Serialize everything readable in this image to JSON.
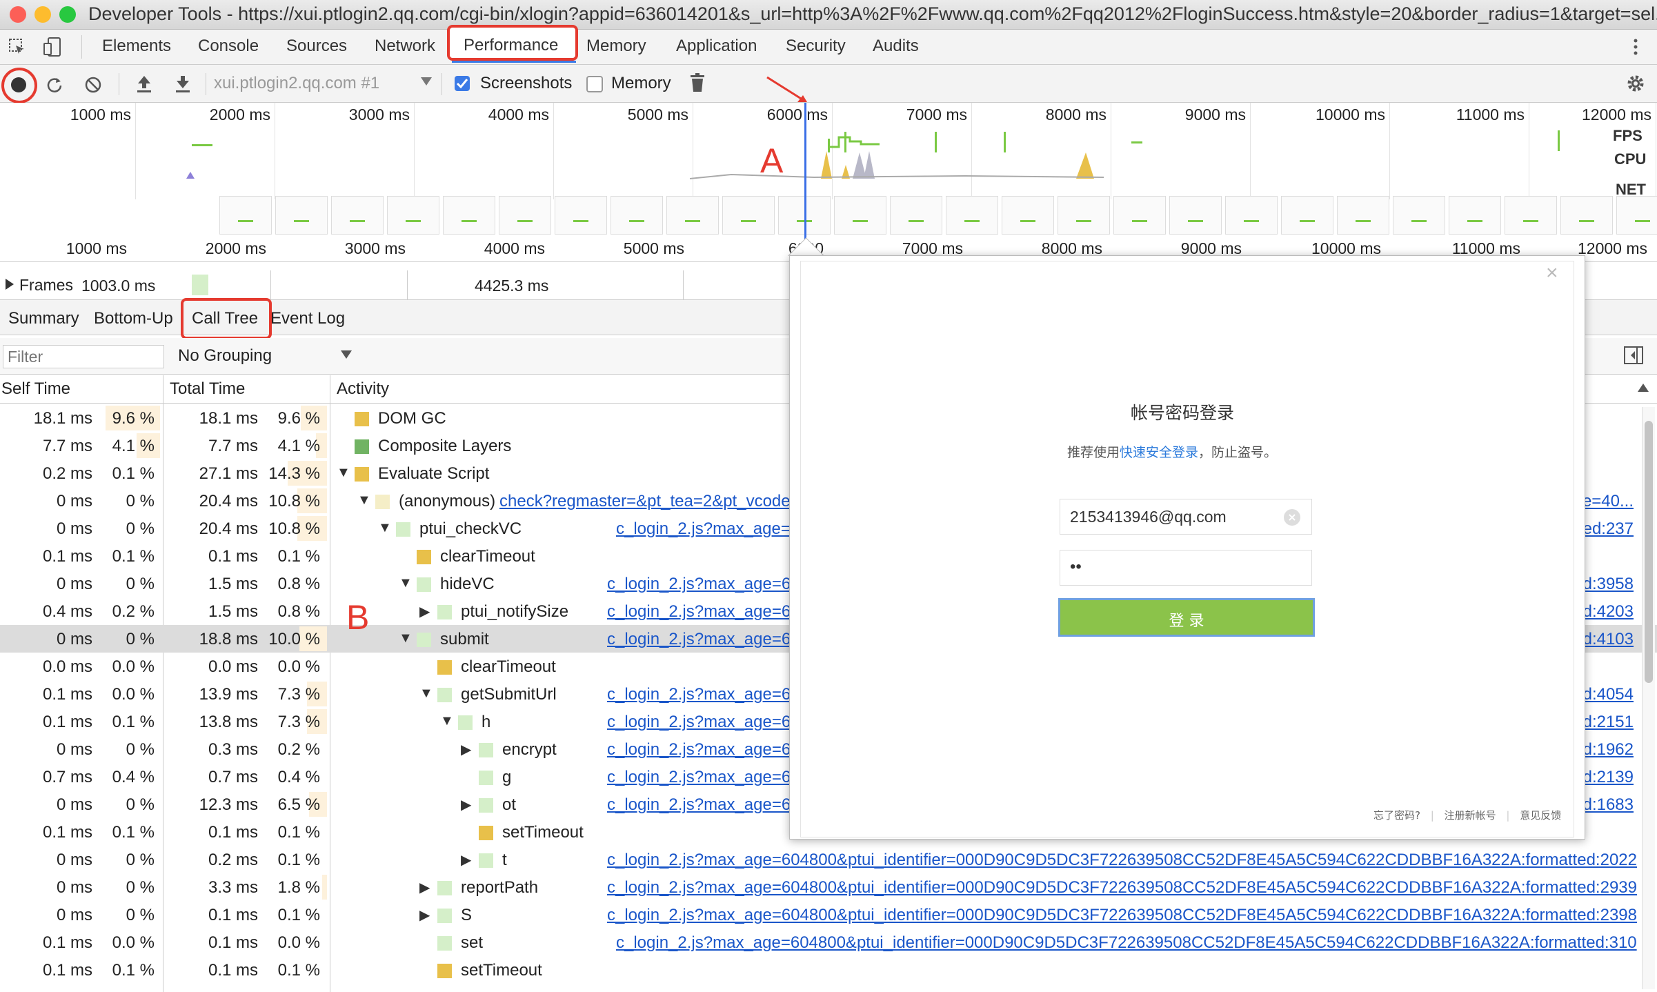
{
  "window": {
    "title": "Developer Tools - https://xui.ptlogin2.qq.com/cgi-bin/xlogin?appid=636014201&s_url=http%3A%2F%2Fwww.qq.com%2Fqq2012%2FloginSuccess.htm&style=20&border_radius=1&target=sel..."
  },
  "colors": {
    "annotation": "#e53a2f",
    "link": "#1a56c9",
    "login_button": "#8bc34a",
    "fps": "#7ac943",
    "cpu_script": "#e8c04a"
  },
  "tabs": [
    "Elements",
    "Console",
    "Sources",
    "Network",
    "Performance",
    "Memory",
    "Application",
    "Security",
    "Audits"
  ],
  "toolbar": {
    "target": "xui.ptlogin2.qq.com #1",
    "screenshots": "Screenshots",
    "memory": "Memory"
  },
  "overview": {
    "ticks_top": [
      "1000 ms",
      "2000 ms",
      "3000 ms",
      "4000 ms",
      "5000 ms",
      "6000 ms",
      "7000 ms",
      "8000 ms",
      "9000 ms",
      "10000 ms",
      "11000 ms",
      "12000 ms"
    ],
    "ticks_bottom": [
      "1000 ms",
      "2000 ms",
      "3000 ms",
      "4000 ms",
      "5000 ms",
      "6000",
      "7000 ms",
      "8000 ms",
      "9000 ms",
      "10000 ms",
      "11000 ms",
      "12000 ms"
    ],
    "labels": {
      "fps": "FPS",
      "cpu": "CPU",
      "net": "NET"
    }
  },
  "frames": {
    "label": "Frames",
    "value1": "1003.0 ms",
    "value2": "4425.3 ms"
  },
  "bottom_tabs": [
    "Summary",
    "Bottom-Up",
    "Call Tree",
    "Event Log"
  ],
  "filter": {
    "placeholder": "Filter",
    "grouping": "No Grouping"
  },
  "headers": {
    "self": "Self Time",
    "total": "Total Time",
    "activity": "Activity"
  },
  "rows": [
    {
      "self": "18.1 ms",
      "selfp": "9.6 %",
      "total": "18.1 ms",
      "totalp": "9.6 %",
      "name": "DOM GC",
      "color": "#e8c04a",
      "link": ""
    },
    {
      "self": "7.7 ms",
      "selfp": "4.1 %",
      "total": "7.7 ms",
      "totalp": "4.1 %",
      "name": "Composite Layers",
      "color": "#71b363",
      "link": ""
    },
    {
      "self": "0.2 ms",
      "selfp": "0.1 %",
      "total": "27.1 ms",
      "totalp": "14.3 %",
      "name": "Evaluate Script",
      "color": "#e8c04a",
      "link": ""
    },
    {
      "self": "0 ms",
      "selfp": "0 %",
      "total": "20.4 ms",
      "totalp": "10.8 %",
      "name": "(anonymous)",
      "color": "#f5eec7",
      "link": "check?regmaster=&pt_tea=2&pt_vcode",
      "link2": "e=40..."
    },
    {
      "self": "0 ms",
      "selfp": "0 %",
      "total": "20.4 ms",
      "totalp": "10.8 %",
      "name": "ptui_checkVC",
      "color": "#d5efc9",
      "link": "c_login_2.js?max_age=",
      "link2": "ted:237"
    },
    {
      "self": "0.1 ms",
      "selfp": "0.1 %",
      "total": "0.1 ms",
      "totalp": "0.1 %",
      "name": "clearTimeout",
      "color": "#e8c04a",
      "link": ""
    },
    {
      "self": "0 ms",
      "selfp": "0 %",
      "total": "1.5 ms",
      "totalp": "0.8 %",
      "name": "hideVC",
      "color": "#d5efc9",
      "link": "c_login_2.js?max_age=6",
      "link2": "d:3958"
    },
    {
      "self": "0.4 ms",
      "selfp": "0.2 %",
      "total": "1.5 ms",
      "totalp": "0.8 %",
      "name": "ptui_notifySize",
      "color": "#d5efc9",
      "link": "c_login_2.js?max_age=6",
      "link2": "d:4203"
    },
    {
      "self": "0 ms",
      "selfp": "0 %",
      "total": "18.8 ms",
      "totalp": "10.0 %",
      "name": "submit",
      "color": "#d5efc9",
      "link": "c_login_2.js?max_age=6",
      "link2": "d:4103"
    },
    {
      "self": "0.0 ms",
      "selfp": "0.0 %",
      "total": "0.0 ms",
      "totalp": "0.0 %",
      "name": "clearTimeout",
      "color": "#e8c04a",
      "link": ""
    },
    {
      "self": "0.1 ms",
      "selfp": "0.0 %",
      "total": "13.9 ms",
      "totalp": "7.3 %",
      "name": "getSubmitUrl",
      "color": "#d5efc9",
      "link": "c_login_2.js?max_age=6",
      "link2": "d:4054"
    },
    {
      "self": "0.1 ms",
      "selfp": "0.1 %",
      "total": "13.8 ms",
      "totalp": "7.3 %",
      "name": "h",
      "color": "#d5efc9",
      "link": "c_login_2.js?max_age=6",
      "link2": "d:2151"
    },
    {
      "self": "0 ms",
      "selfp": "0 %",
      "total": "0.3 ms",
      "totalp": "0.2 %",
      "name": "encrypt",
      "color": "#d5efc9",
      "link": "c_login_2.js?max_age=6",
      "link2": "d:1962"
    },
    {
      "self": "0.7 ms",
      "selfp": "0.4 %",
      "total": "0.7 ms",
      "totalp": "0.4 %",
      "name": "g",
      "color": "#d5efc9",
      "link": "c_login_2.js?max_age=6",
      "link2": "d:2139"
    },
    {
      "self": "0 ms",
      "selfp": "0 %",
      "total": "12.3 ms",
      "totalp": "6.5 %",
      "name": "ot",
      "color": "#d5efc9",
      "link": "c_login_2.js?max_age=6",
      "link2": "d:1683"
    },
    {
      "self": "0.1 ms",
      "selfp": "0.1 %",
      "total": "0.1 ms",
      "totalp": "0.1 %",
      "name": "setTimeout",
      "color": "#e8c04a",
      "link": ""
    },
    {
      "self": "0 ms",
      "selfp": "0 %",
      "total": "0.2 ms",
      "totalp": "0.1 %",
      "name": "t",
      "color": "#d5efc9",
      "link": "c_login_2.js?max_age=604800&ptui_identifier=000D90C9D5DC3F722639508CC52DF8E45A5C594C622CDDBBF16A322A:formatted:2022"
    },
    {
      "self": "0 ms",
      "selfp": "0 %",
      "total": "3.3 ms",
      "totalp": "1.8 %",
      "name": "reportPath",
      "color": "#d5efc9",
      "link": "c_login_2.js?max_age=604800&ptui_identifier=000D90C9D5DC3F722639508CC52DF8E45A5C594C622CDDBBF16A322A:formatted:2939"
    },
    {
      "self": "0 ms",
      "selfp": "0 %",
      "total": "0.1 ms",
      "totalp": "0.1 %",
      "name": "S",
      "color": "#d5efc9",
      "link": "c_login_2.js?max_age=604800&ptui_identifier=000D90C9D5DC3F722639508CC52DF8E45A5C594C622CDDBBF16A322A:formatted:2398"
    },
    {
      "self": "0.1 ms",
      "selfp": "0.0 %",
      "total": "0.1 ms",
      "totalp": "0.0 %",
      "name": "set",
      "color": "#d5efc9",
      "link": "c_login_2.js?max_age=604800&ptui_identifier=000D90C9D5DC3F722639508CC52DF8E45A5C594C622CDDBBF16A322A:formatted:310"
    },
    {
      "self": "0.1 ms",
      "selfp": "0.1 %",
      "total": "0.1 ms",
      "totalp": "0.1 %",
      "name": "setTimeout",
      "color": "#e8c04a",
      "link": ""
    }
  ],
  "login": {
    "title": "帐号密码登录",
    "subtitle_pre": "推荐使用",
    "subtitle_link": "快速安全登录",
    "subtitle_post": "，防止盗号。",
    "username": "2153413946@qq.com",
    "password": "••",
    "button": "登 录",
    "footer": [
      "忘了密码?",
      "注册新帐号",
      "意见反馈"
    ],
    "close": "×"
  },
  "annotations": {
    "a": "A",
    "b": "B"
  }
}
